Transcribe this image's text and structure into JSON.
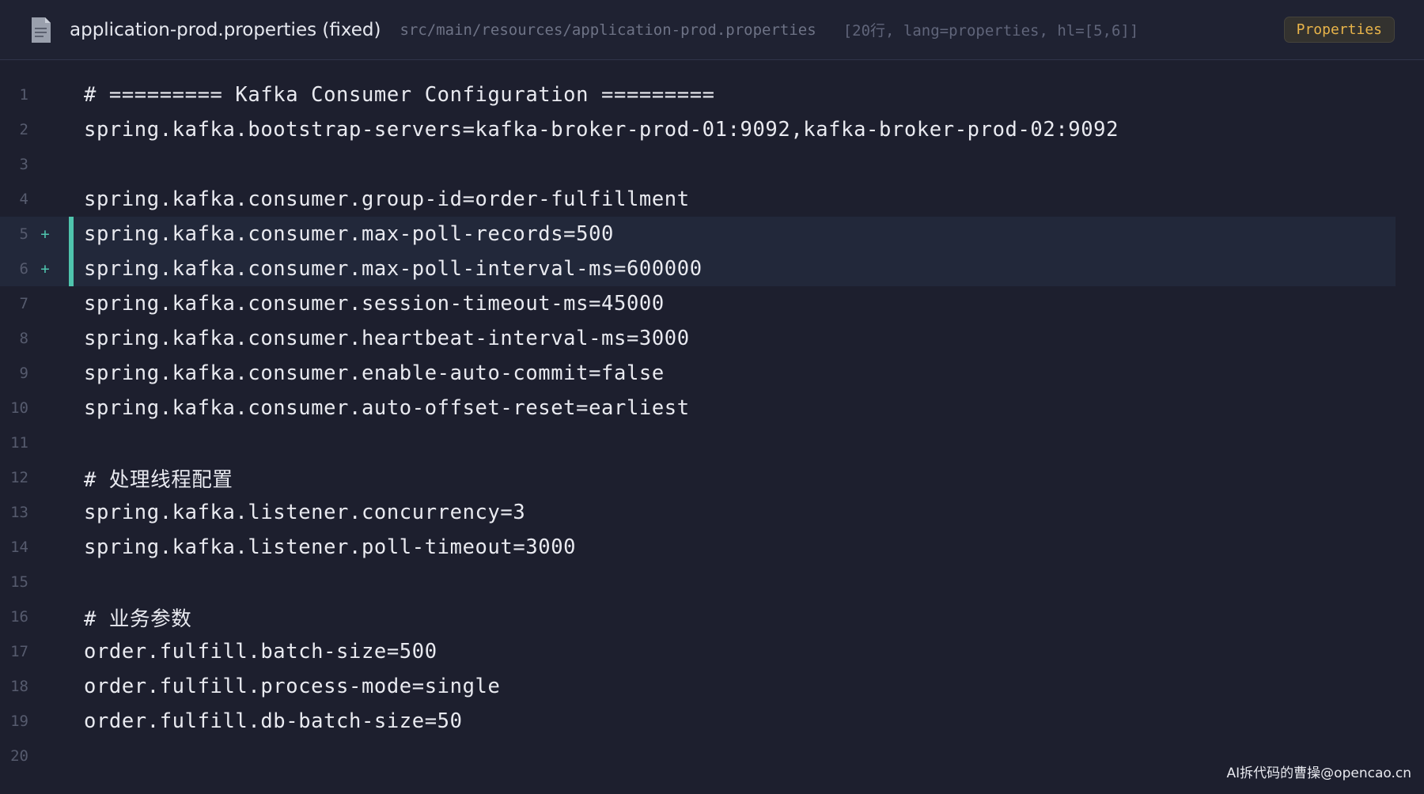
{
  "header": {
    "title": "application-prod.properties (fixed)",
    "path": "src/main/resources/application-prod.properties",
    "meta": "[20行, lang=properties, hl=[5,6]]",
    "language_badge": "Properties",
    "file_icon": "document-icon"
  },
  "code": {
    "lines": [
      {
        "n": "1",
        "marker": "",
        "text": "# ========= Kafka Consumer Configuration =========",
        "highlight": false
      },
      {
        "n": "2",
        "marker": "",
        "text": "spring.kafka.bootstrap-servers=kafka-broker-prod-01:9092,kafka-broker-prod-02:9092",
        "highlight": false
      },
      {
        "n": "3",
        "marker": "",
        "text": "",
        "highlight": false
      },
      {
        "n": "4",
        "marker": "",
        "text": "spring.kafka.consumer.group-id=order-fulfillment",
        "highlight": false
      },
      {
        "n": "5",
        "marker": "+",
        "text": "spring.kafka.consumer.max-poll-records=500",
        "highlight": true
      },
      {
        "n": "6",
        "marker": "+",
        "text": "spring.kafka.consumer.max-poll-interval-ms=600000",
        "highlight": true
      },
      {
        "n": "7",
        "marker": "",
        "text": "spring.kafka.consumer.session-timeout-ms=45000",
        "highlight": false
      },
      {
        "n": "8",
        "marker": "",
        "text": "spring.kafka.consumer.heartbeat-interval-ms=3000",
        "highlight": false
      },
      {
        "n": "9",
        "marker": "",
        "text": "spring.kafka.consumer.enable-auto-commit=false",
        "highlight": false
      },
      {
        "n": "10",
        "marker": "",
        "text": "spring.kafka.consumer.auto-offset-reset=earliest",
        "highlight": false
      },
      {
        "n": "11",
        "marker": "",
        "text": "",
        "highlight": false
      },
      {
        "n": "12",
        "marker": "",
        "text": "# 处理线程配置",
        "highlight": false
      },
      {
        "n": "13",
        "marker": "",
        "text": "spring.kafka.listener.concurrency=3",
        "highlight": false
      },
      {
        "n": "14",
        "marker": "",
        "text": "spring.kafka.listener.poll-timeout=3000",
        "highlight": false
      },
      {
        "n": "15",
        "marker": "",
        "text": "",
        "highlight": false
      },
      {
        "n": "16",
        "marker": "",
        "text": "# 业务参数",
        "highlight": false
      },
      {
        "n": "17",
        "marker": "",
        "text": "order.fulfill.batch-size=500",
        "highlight": false
      },
      {
        "n": "18",
        "marker": "",
        "text": "order.fulfill.process-mode=single",
        "highlight": false
      },
      {
        "n": "19",
        "marker": "",
        "text": "order.fulfill.db-batch-size=50",
        "highlight": false
      },
      {
        "n": "20",
        "marker": "",
        "text": "",
        "highlight": false
      }
    ]
  },
  "watermark": "AI拆代码的曹操@opencao.cn",
  "colors": {
    "background": "#1d1f2e",
    "highlight_bar": "#4fc4ad",
    "badge_text": "#e8b44a"
  }
}
